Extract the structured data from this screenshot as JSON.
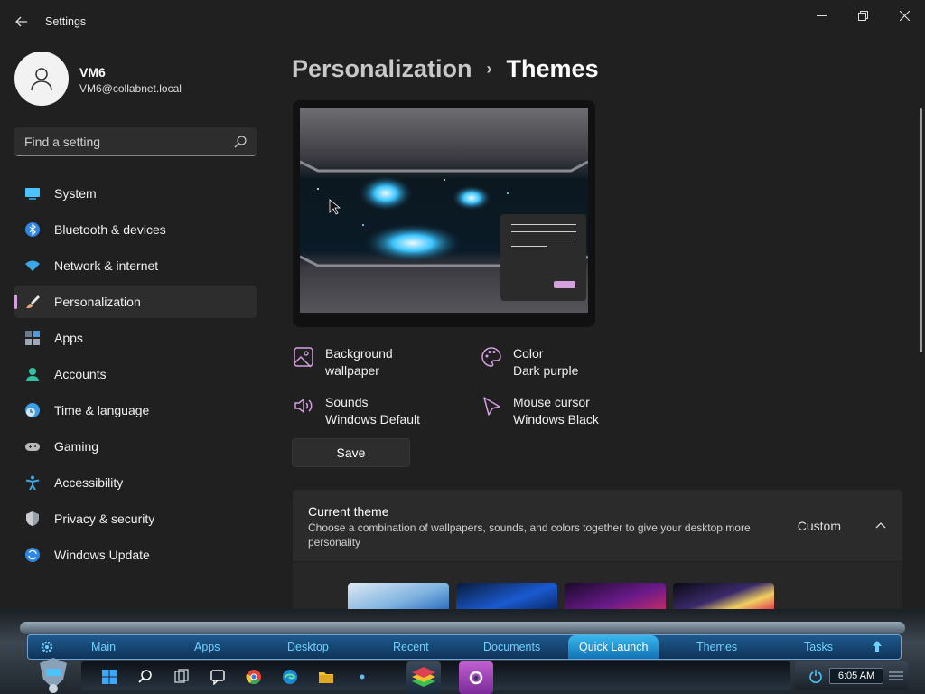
{
  "window": {
    "title": "Settings",
    "back_icon": "arrow-left-icon",
    "minimize_icon": "minimize-icon",
    "maximize_icon": "restore-icon",
    "close_icon": "close-icon"
  },
  "profile": {
    "name": "VM6",
    "email": "VM6@collabnet.local",
    "avatar_icon": "person-icon"
  },
  "search": {
    "placeholder": "Find a setting",
    "icon": "search-icon"
  },
  "sidebar": {
    "items": [
      {
        "label": "System",
        "icon": "monitor-icon",
        "color": "#4cc2ff"
      },
      {
        "label": "Bluetooth & devices",
        "icon": "bluetooth-icon",
        "color": "#2f86e5"
      },
      {
        "label": "Network & internet",
        "icon": "wifi-icon",
        "color": "#3aa8e8"
      },
      {
        "label": "Personalization",
        "icon": "brush-icon",
        "color": "#e8a87c",
        "active": true
      },
      {
        "label": "Apps",
        "icon": "apps-icon",
        "color": "#a0a8b8"
      },
      {
        "label": "Accounts",
        "icon": "person-icon",
        "color": "#2fc1a0"
      },
      {
        "label": "Time & language",
        "icon": "globe-clock-icon",
        "color": "#3a9ee8"
      },
      {
        "label": "Gaming",
        "icon": "gamepad-icon",
        "color": "#b8b8b8"
      },
      {
        "label": "Accessibility",
        "icon": "accessibility-icon",
        "color": "#3aa8e8"
      },
      {
        "label": "Privacy & security",
        "icon": "shield-icon",
        "color": "#9aa0a8"
      },
      {
        "label": "Windows Update",
        "icon": "update-icon",
        "color": "#2f86e5"
      }
    ]
  },
  "breadcrumb": {
    "parent": "Personalization",
    "separator": "›",
    "current": "Themes"
  },
  "theme_tiles": {
    "background": {
      "title": "Background",
      "value": "wallpaper",
      "icon": "image-icon"
    },
    "color": {
      "title": "Color",
      "value": "Dark purple",
      "icon": "palette-icon"
    },
    "sounds": {
      "title": "Sounds",
      "value": "Windows Default",
      "icon": "speaker-icon"
    },
    "cursor": {
      "title": "Mouse cursor",
      "value": "Windows Black",
      "icon": "cursor-icon"
    }
  },
  "save_label": "Save",
  "current_theme": {
    "title": "Current theme",
    "description": "Choose a combination of wallpapers, sounds, and colors together to give your desktop more personality",
    "value": "Custom",
    "icon": "chevron-up-icon"
  },
  "accent_color": "#d39fde",
  "dock": {
    "tabs": [
      "Main",
      "Apps",
      "Desktop",
      "Recent",
      "Documents",
      "Quick Launch",
      "Themes",
      "Tasks"
    ],
    "active_tab": "Quick Launch",
    "clock": "6:05 AM"
  }
}
